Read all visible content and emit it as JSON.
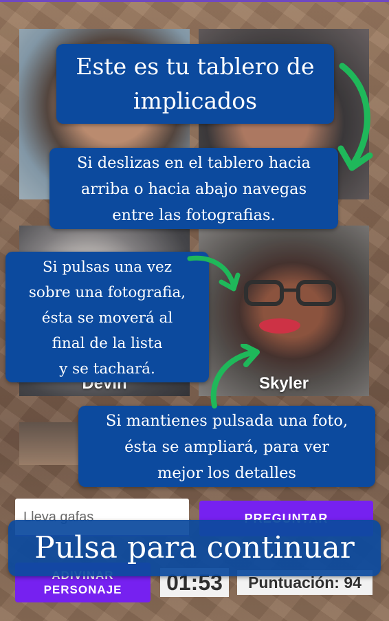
{
  "board": {
    "photos": [
      {
        "name": ""
      },
      {
        "name": ""
      },
      {
        "name": "Devin"
      },
      {
        "name": "Skyler"
      },
      {
        "name": ""
      },
      {
        "name": ""
      }
    ]
  },
  "controls": {
    "question_input_value": "Lleva gafas",
    "ask_button": "PREGUNTAR",
    "guess_button_line1": "ADIVINAR",
    "guess_button_line2": "PERSONAJE",
    "timer": "01:53",
    "score": "Puntuación: 94"
  },
  "tutorial": {
    "title_line1": "Este es tu tablero de",
    "title_line2": "implicados",
    "swipe_line1": "Si deslizas en el tablero hacia",
    "swipe_line2": "arriba o hacia abajo navegas",
    "swipe_line3": "entre las fotografias.",
    "tap_line1": "Si pulsas una vez",
    "tap_line2": "sobre una fotografia,",
    "tap_line3": "ésta se moverá al",
    "tap_line4": "final de la lista",
    "tap_line5": "y se tachará.",
    "hold_line1": "Si mantienes pulsada una foto,",
    "hold_line2": "ésta se ampliará, para ver",
    "hold_line3": "mejor los detalles",
    "continue": "Pulsa para continuar"
  },
  "colors": {
    "primary_button": "#6200ee",
    "tip_background": "#0c4a9e",
    "arrow": "#1fb85a"
  }
}
